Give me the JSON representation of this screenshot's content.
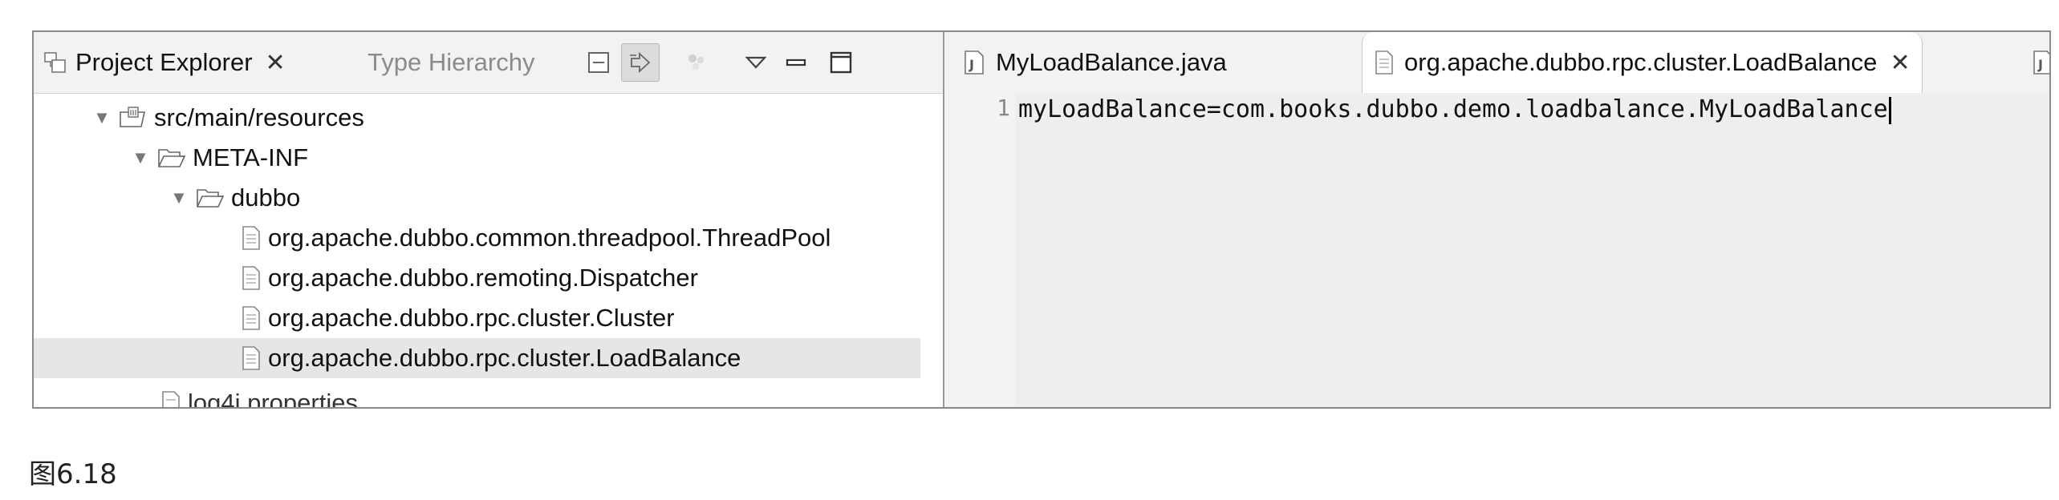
{
  "left_panel": {
    "tabs": [
      {
        "label": "Project Explorer",
        "close_glyph": "✕",
        "active": true,
        "icon": "project-explorer-icon"
      },
      {
        "label": "Type Hierarchy",
        "active": false,
        "icon": ""
      }
    ],
    "toolbar_icons": [
      "collapse-all-icon",
      "link-with-editor-icon",
      "focus-icon",
      "view-menu-icon",
      "minimize-icon",
      "maximize-icon"
    ],
    "tree": [
      {
        "label": "src/main/resources",
        "icon": "source-folder-icon",
        "expanded": true
      },
      {
        "label": "META-INF",
        "icon": "folder-icon",
        "expanded": true
      },
      {
        "label": "dubbo",
        "icon": "folder-icon",
        "expanded": true
      },
      {
        "label": "org.apache.dubbo.common.threadpool.ThreadPool",
        "icon": "file-icon"
      },
      {
        "label": "org.apache.dubbo.remoting.Dispatcher",
        "icon": "file-icon"
      },
      {
        "label": "org.apache.dubbo.rpc.cluster.Cluster",
        "icon": "file-icon"
      },
      {
        "label": "org.apache.dubbo.rpc.cluster.LoadBalance",
        "icon": "file-icon",
        "selected": true
      },
      {
        "label": "log4j.properties",
        "icon": "file-icon",
        "partially_hidden": true
      }
    ]
  },
  "editor": {
    "tabs": [
      {
        "label": "MyLoadBalance.java",
        "icon": "java-file-icon",
        "active": false
      },
      {
        "label": "org.apache.dubbo.rpc.cluster.LoadBalance",
        "close_glyph": "✕",
        "icon": "text-file-icon",
        "active": true
      },
      {
        "label": "",
        "icon": "java-file-icon",
        "active": false
      }
    ],
    "lines": [
      {
        "number": "1",
        "text": "myLoadBalance=com.books.dubbo.demo.loadbalance.MyLoadBalance"
      }
    ]
  },
  "caption": "图6.18",
  "colors": {
    "tabbar_bg": "#f2f2f2",
    "selection_bg": "#e6e6e6",
    "editor_bg": "#eeeeee",
    "gutter_bg": "#f3f3f3"
  }
}
